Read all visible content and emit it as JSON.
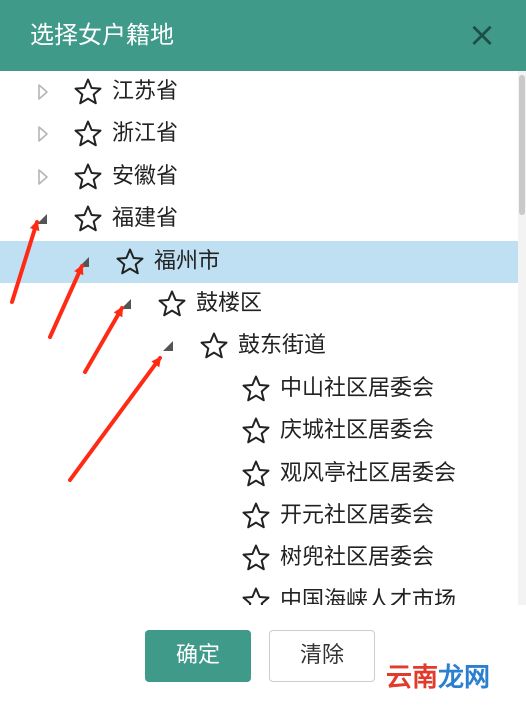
{
  "dialog": {
    "title": "选择女户籍地",
    "close_glyph": "×",
    "accent_color": "#3f9a8a",
    "selected_row_color": "#bfe0f2"
  },
  "tree": {
    "nodes": [
      {
        "label": "江苏省",
        "level": 0,
        "toggle": "collapsed",
        "star": "star-outline-icon"
      },
      {
        "label": "浙江省",
        "level": 0,
        "toggle": "collapsed",
        "star": "star-outline-icon"
      },
      {
        "label": "安徽省",
        "level": 0,
        "toggle": "collapsed",
        "star": "star-outline-icon"
      },
      {
        "label": "福建省",
        "level": 0,
        "toggle": "expanded",
        "star": "star-outline-icon"
      },
      {
        "label": "福州市",
        "level": 1,
        "toggle": "expanded",
        "star": "star-outline-icon",
        "selected": true
      },
      {
        "label": "鼓楼区",
        "level": 2,
        "toggle": "expanded",
        "star": "star-outline-icon"
      },
      {
        "label": "鼓东街道",
        "level": 3,
        "toggle": "expanded",
        "star": "star-outline-icon"
      },
      {
        "label": "中山社区居委会",
        "level": 4,
        "toggle": "none",
        "star": "star-outline-icon"
      },
      {
        "label": "庆城社区居委会",
        "level": 4,
        "toggle": "none",
        "star": "star-outline-icon"
      },
      {
        "label": "观风亭社区居委会",
        "level": 4,
        "toggle": "none",
        "star": "star-outline-icon"
      },
      {
        "label": "开元社区居委会",
        "level": 4,
        "toggle": "none",
        "star": "star-outline-icon"
      },
      {
        "label": "树兜社区居委会",
        "level": 4,
        "toggle": "none",
        "star": "star-outline-icon"
      },
      {
        "label": "中国海峡人才市场",
        "level": 4,
        "toggle": "none",
        "star": "star-outline-icon"
      }
    ]
  },
  "footer": {
    "confirm_label": "确定",
    "clear_label": "清除"
  },
  "watermark": {
    "part_a": "云南",
    "part_b": "龙网"
  },
  "annotation": {
    "arrow_color": "#ff2a14"
  }
}
